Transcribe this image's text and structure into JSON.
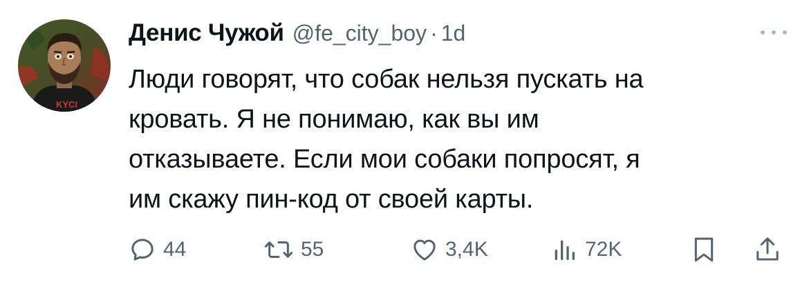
{
  "author": {
    "name": "Денис Чужой",
    "handle": "@fe_city_boy",
    "separator": "·",
    "time": "1d"
  },
  "avatar": {
    "shirt_text": "KYCI"
  },
  "tweet": {
    "text": "Люди говорят, что собак нельзя пускать на\nкровать. Я не понимаю, как вы им\nотказываете. Если мои собаки попросят, я\nим скажу пин-код от своей карты."
  },
  "actions": {
    "replies": "44",
    "retweets": "55",
    "likes": "3,4K",
    "views": "72K"
  },
  "icons": {
    "reply": "reply-icon",
    "retweet": "retweet-icon",
    "like": "heart-icon",
    "views": "views-chart-icon",
    "bookmark": "bookmark-icon",
    "share": "share-icon",
    "more": "more-dots-icon"
  },
  "colors": {
    "text": "#0f1419",
    "secondary": "#536471",
    "avatar_bg": "#3b4d2a",
    "avatar_accent": "#b0302a"
  }
}
